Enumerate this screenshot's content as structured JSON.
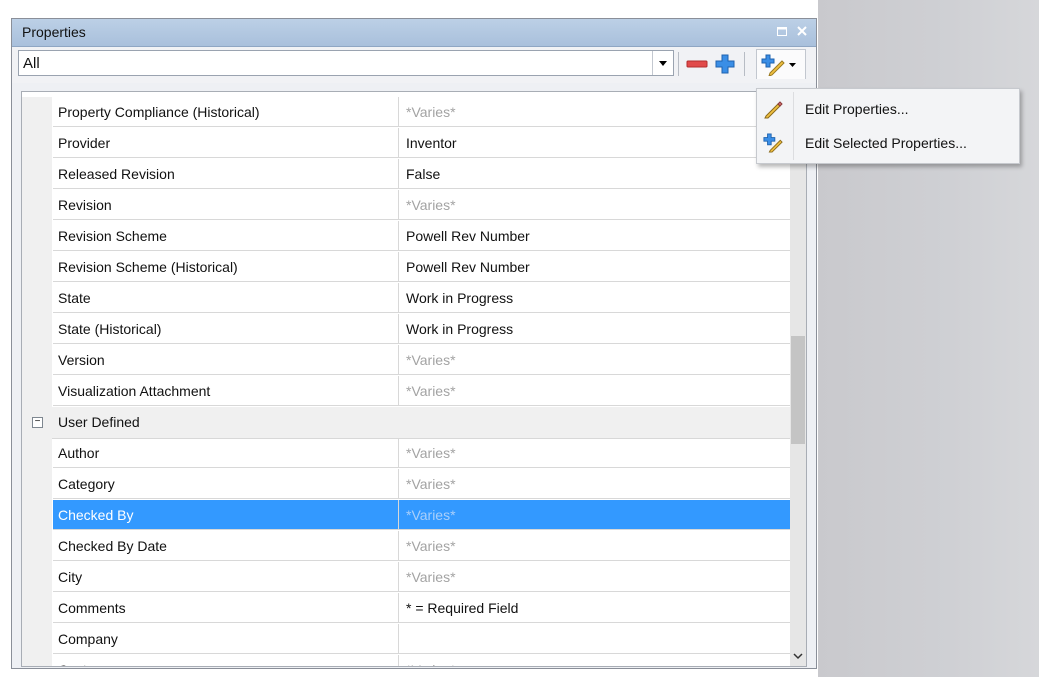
{
  "panel": {
    "title": "Properties",
    "filter_value": "All"
  },
  "rows_top": [
    {
      "name": "Property Compliance (Historical)",
      "value": "*Varies*",
      "varies": true
    },
    {
      "name": "Provider",
      "value": "Inventor",
      "varies": false
    },
    {
      "name": "Released Revision",
      "value": "False",
      "varies": false
    },
    {
      "name": "Revision",
      "value": "*Varies*",
      "varies": true
    },
    {
      "name": "Revision Scheme",
      "value": "Powell Rev Number",
      "varies": false
    },
    {
      "name": "Revision Scheme (Historical)",
      "value": "Powell Rev Number",
      "varies": false
    },
    {
      "name": "State",
      "value": "Work in Progress",
      "varies": false
    },
    {
      "name": "State (Historical)",
      "value": "Work in Progress",
      "varies": false
    },
    {
      "name": "Version",
      "value": "*Varies*",
      "varies": true
    },
    {
      "name": "Visualization Attachment",
      "value": "*Varies*",
      "varies": true
    }
  ],
  "category": {
    "label": "User Defined",
    "toggle": "−"
  },
  "rows_user": [
    {
      "name": "Author",
      "value": "*Varies*",
      "varies": true
    },
    {
      "name": "Category",
      "value": "*Varies*",
      "varies": true
    },
    {
      "name": "Checked By",
      "value": "*Varies*",
      "varies": true,
      "selected": true
    },
    {
      "name": "Checked By Date",
      "value": "*Varies*",
      "varies": true
    },
    {
      "name": "City",
      "value": "*Varies*",
      "varies": true
    },
    {
      "name": "Comments",
      "value": "* =  Required Field",
      "varies": false
    },
    {
      "name": "Company",
      "value": "",
      "varies": false
    },
    {
      "name": "Cust...",
      "value": "*Varies*",
      "varies": true
    }
  ],
  "menu": {
    "items": [
      {
        "label": "Edit Properties...",
        "icon": "pencil-icon"
      },
      {
        "label": "Edit Selected Properties...",
        "icon": "edit-selected-icon"
      }
    ]
  },
  "colors": {
    "selection": "#3399ff",
    "titlebar": "#b3c8e1",
    "varies_text": "#a3a3a3"
  }
}
